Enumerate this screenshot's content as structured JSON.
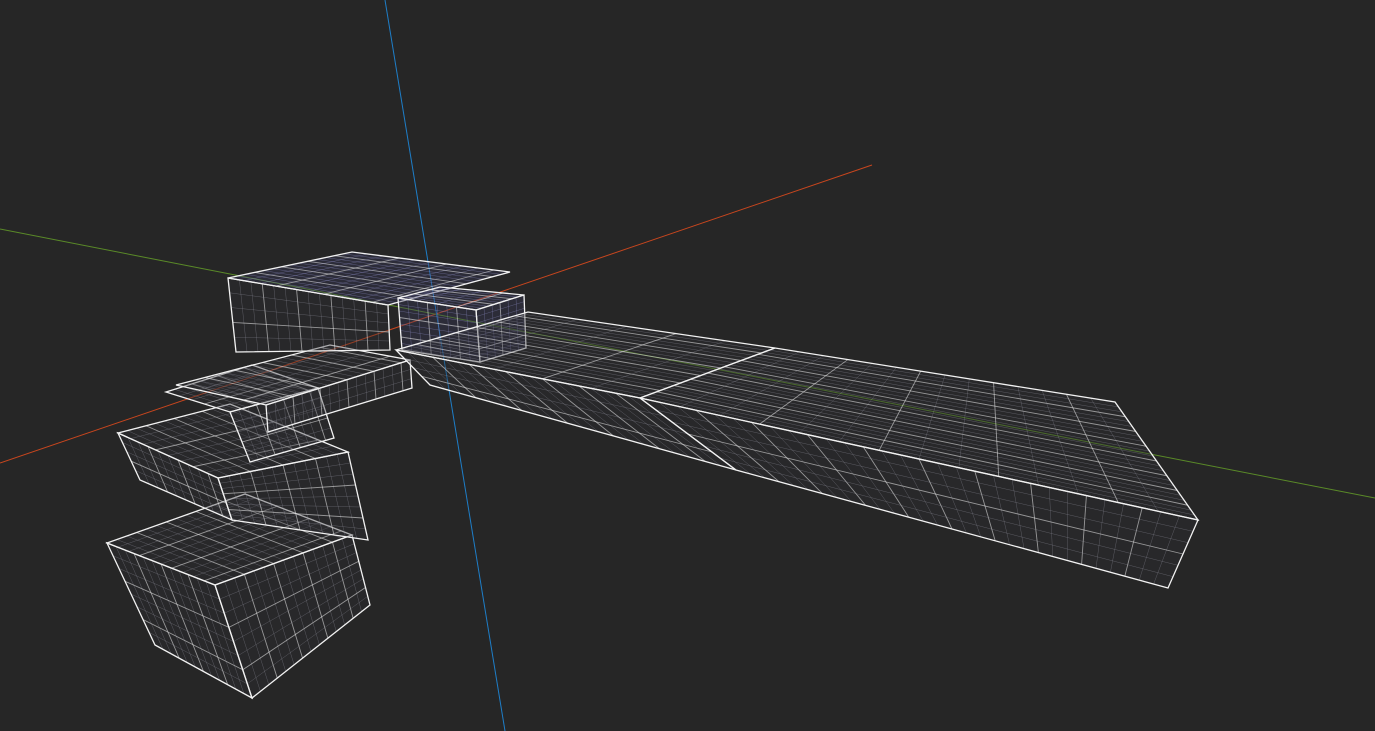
{
  "viewport": {
    "background": "#262626",
    "view_mode": "wireframe",
    "grid_divisions_per_face": 12
  },
  "axes": {
    "x_color": "#c8461e",
    "y_color": "#5a8a28",
    "z_color": "#1e7ec8"
  },
  "mesh": {
    "edge_color": "#f2f2f2",
    "fine_grid_color": "#9a9aa6",
    "face_fill": "#2f2f33",
    "highlight_fill": "#3a3a5c",
    "highlight_grid_color": "#9a9ad8"
  }
}
